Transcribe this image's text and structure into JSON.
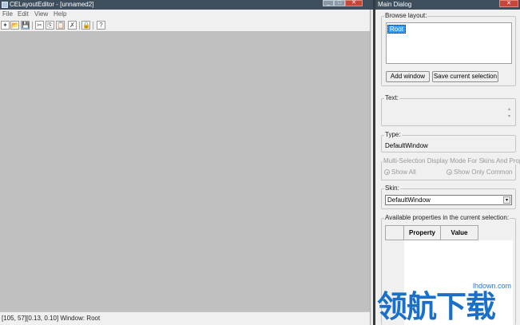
{
  "editor": {
    "title": "CELayoutEditor - [unnamed2]",
    "window_buttons": {
      "minimize": "_",
      "maximize": "□",
      "close": "✕"
    },
    "menu": [
      "File",
      "Edit",
      "View",
      "Help"
    ],
    "toolbar": {
      "icons": [
        "new-icon",
        "open-icon",
        "save-icon",
        "cut-icon",
        "copy-icon",
        "paste-icon",
        "delete-icon",
        "lock-icon",
        "help-icon"
      ],
      "glyphs": [
        "✦",
        "📂",
        "💾",
        "✂",
        "⎘",
        "📋",
        "✗",
        "🔒",
        "?"
      ]
    },
    "status": "[105, 57][0.13, 0.10] Window: Root"
  },
  "dialog": {
    "title": "Main Dialog",
    "close": "✕",
    "browse_layout": {
      "label": "Browse layout:",
      "items": [
        "Root"
      ],
      "add_window": "Add window",
      "save_selection": "Save current selection"
    },
    "text": {
      "label": "Text:",
      "up": "▴",
      "down": "▾"
    },
    "type": {
      "label": "Type:",
      "value": "DefaultWindow"
    },
    "multi_selection": {
      "label": "Multi-Selection Display Mode For Skins And Propertie",
      "show_all": "Show All",
      "show_only_common": "Show Only Common"
    },
    "skin": {
      "label": "Skin:",
      "value": "DefaultWindow",
      "arrow": "▾"
    },
    "properties": {
      "label": "Available properties in the current selection:",
      "columns": [
        "Property",
        "Value"
      ]
    }
  },
  "watermark": {
    "url": "lhdown.com",
    "text": "领航下载"
  },
  "colors": {
    "titlebar": "#3f4e5c",
    "canvas": "#c0c0c0",
    "selection": "#3399ff",
    "close": "#c8453a"
  }
}
